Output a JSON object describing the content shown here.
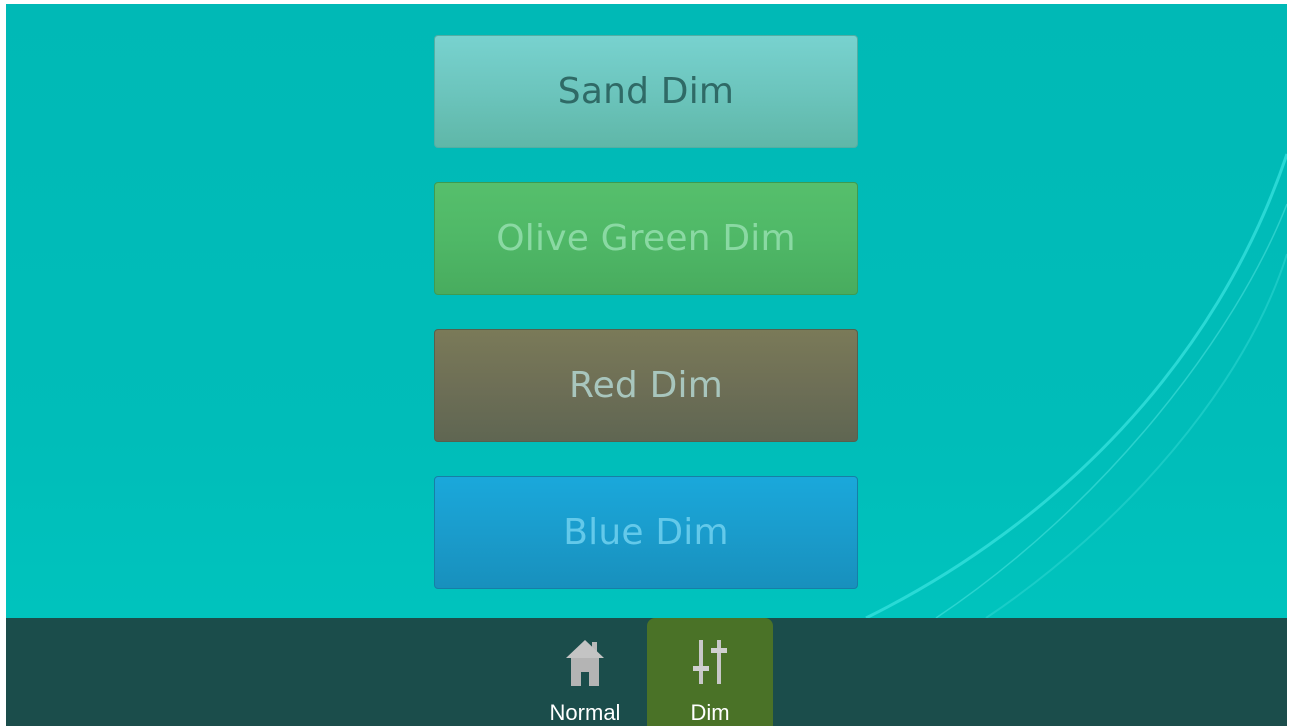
{
  "buttons": {
    "sand": "Sand Dim",
    "olive": "Olive Green Dim",
    "red": "Red Dim",
    "blue": "Blue Dim"
  },
  "bottom_nav": {
    "normal": {
      "label": "Normal",
      "icon": "home-icon"
    },
    "dim": {
      "label": "Dim",
      "icon": "sliders-icon",
      "selected": true
    }
  },
  "colors": {
    "background": "#00bdb9",
    "bottom_bar": "#1b4d4b",
    "selected_tab": "#4a7227"
  }
}
